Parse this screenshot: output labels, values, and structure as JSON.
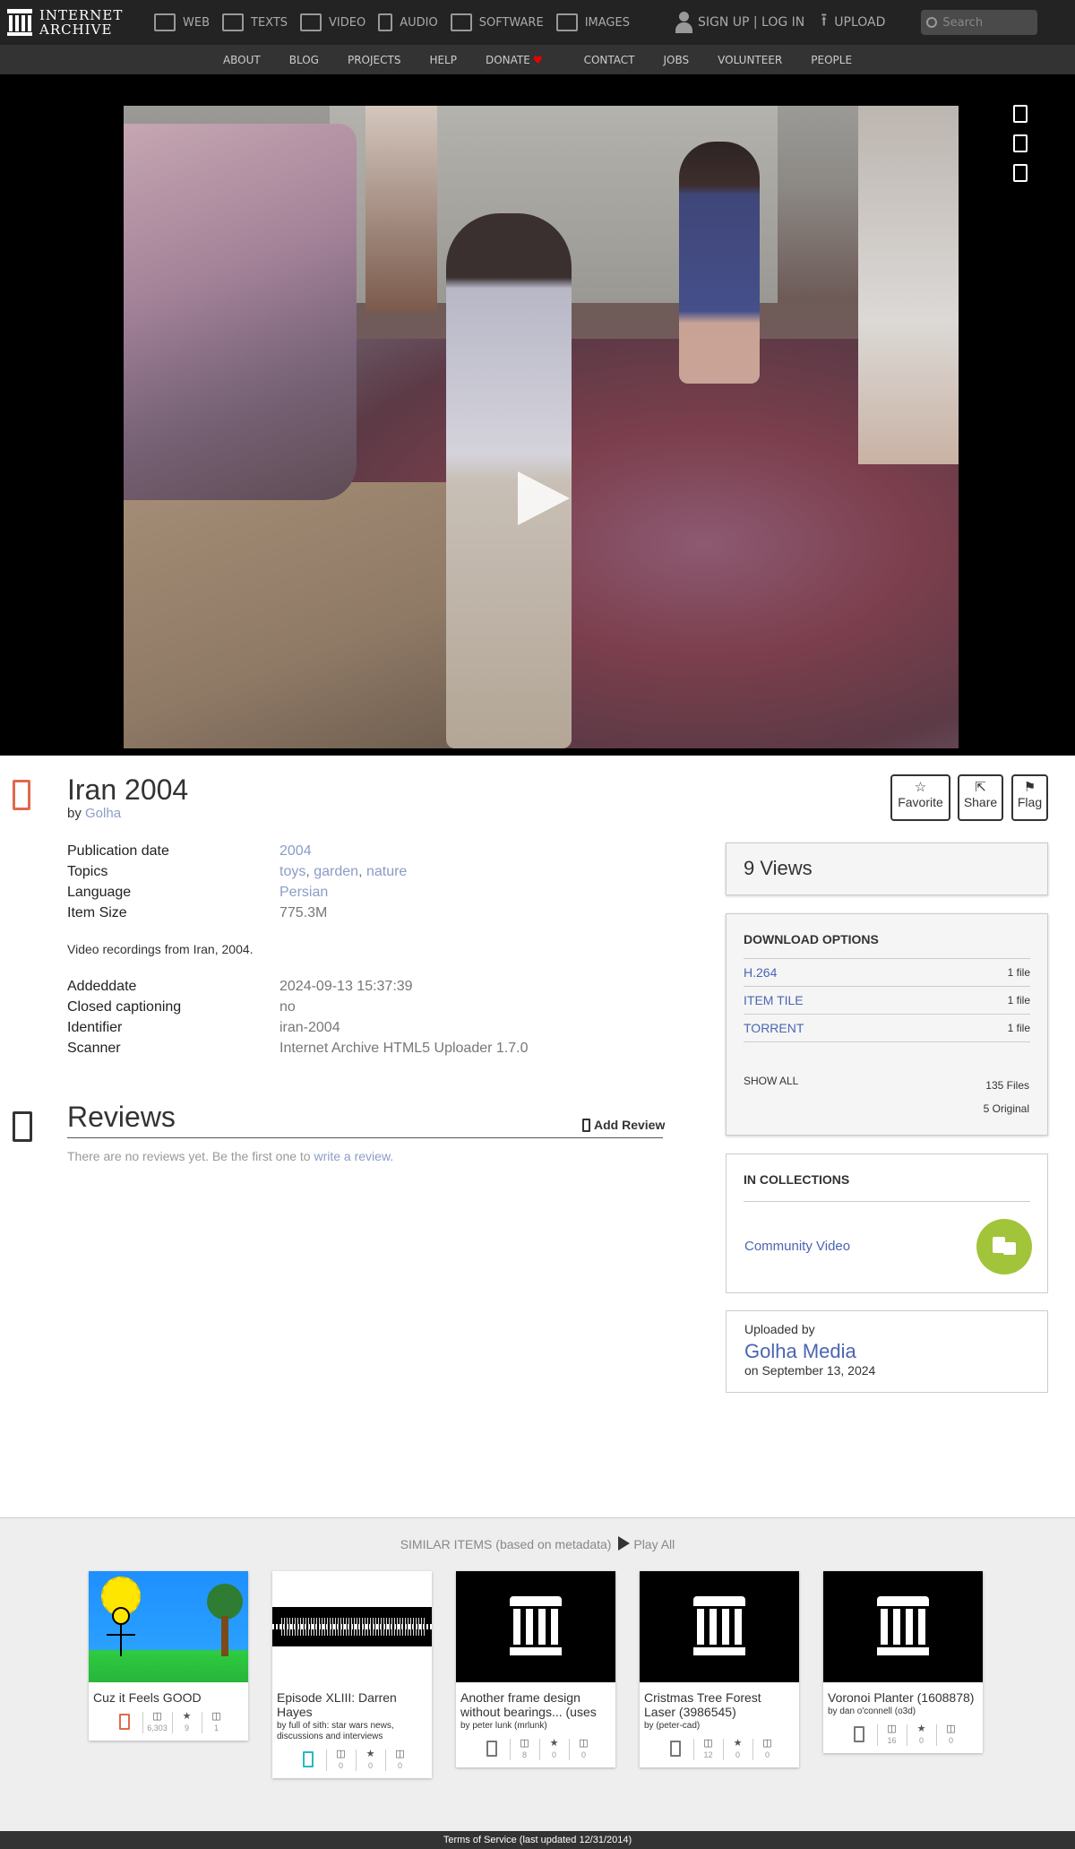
{
  "topnav": {
    "logo_line1": "INTERNET",
    "logo_line2": "ARCHIVE",
    "items": [
      {
        "label": "WEB",
        "icon": "web-icon"
      },
      {
        "label": "TEXTS",
        "icon": "book-icon"
      },
      {
        "label": "VIDEO",
        "icon": "film-icon"
      },
      {
        "label": "AUDIO",
        "icon": "speaker-icon"
      },
      {
        "label": "SOFTWARE",
        "icon": "floppy-icon"
      },
      {
        "label": "IMAGES",
        "icon": "image-icon"
      }
    ],
    "signup_label": "SIGN UP | LOG IN",
    "upload_label": "UPLOAD",
    "search_placeholder": "Search"
  },
  "subnav": [
    "ABOUT",
    "BLOG",
    "PROJECTS",
    "HELP",
    "DONATE",
    "CONTACT",
    "JOBS",
    "VOLUNTEER",
    "PEOPLE"
  ],
  "item": {
    "title": "Iran 2004",
    "by_prefix": "by",
    "creator": "Golha",
    "actions": {
      "favorite": "Favorite",
      "share": "Share",
      "flag": "Flag"
    },
    "metadata": {
      "pubdate_key": "Publication date",
      "pubdate": "2004",
      "topics_key": "Topics",
      "topics": [
        "toys",
        "garden",
        "nature"
      ],
      "language_key": "Language",
      "language": "Persian",
      "size_key": "Item Size",
      "size": "775.3M",
      "description": "Video recordings from Iran, 2004.",
      "addeddate_key": "Addeddate",
      "addeddate": "2024-09-13 15:37:39",
      "cc_key": "Closed captioning",
      "cc": "no",
      "identifier_key": "Identifier",
      "identifier": "iran-2004",
      "scanner_key": "Scanner",
      "scanner": "Internet Archive HTML5 Uploader 1.7.0"
    }
  },
  "reviews": {
    "title": "Reviews",
    "add_label": "Add Review",
    "empty_text": "There are no reviews yet. Be the first one to",
    "empty_link": "write a review",
    "empty_end": "."
  },
  "sidebar": {
    "views": "9 Views",
    "download_title": "DOWNLOAD OPTIONS",
    "downloads": [
      {
        "name": "H.264",
        "count": "1 file"
      },
      {
        "name": "ITEM TILE",
        "count": "1 file"
      },
      {
        "name": "TORRENT",
        "count": "1 file"
      }
    ],
    "show_all": "SHOW ALL",
    "total_files": "135 Files",
    "original_files": "5 Original",
    "collections_title": "IN COLLECTIONS",
    "collection": "Community Video",
    "uploaded_by_label": "Uploaded by",
    "uploader": "Golha Media",
    "uploaded_on": "on September 13, 2024"
  },
  "similar": {
    "heading": "SIMILAR ITEMS (based on metadata)",
    "play_all": "Play All",
    "cards": [
      {
        "title": "Cuz it Feels GOOD",
        "by": "",
        "views": "6,303",
        "favs": "9",
        "reviews": "1",
        "media": "movies"
      },
      {
        "title": "Episode XLIII: Darren Hayes",
        "by": "by full of sith: star wars news, discussions and interviews",
        "views": "0",
        "favs": "0",
        "reviews": "0",
        "media": "audio"
      },
      {
        "title": "Another frame design without bearings... (uses",
        "by": "by peter lunk (mrlunk)",
        "views": "8",
        "favs": "0",
        "reviews": "0",
        "media": "data"
      },
      {
        "title": "Cristmas Tree Forest Laser (3986545)",
        "by": "by (peter-cad)",
        "views": "12",
        "favs": "0",
        "reviews": "0",
        "media": "data"
      },
      {
        "title": "Voronoi Planter (1608878)",
        "by": "by dan o'connell (o3d)",
        "views": "16",
        "favs": "0",
        "reviews": "0",
        "media": "data"
      }
    ]
  },
  "footer": "Terms of Service (last updated 12/31/2014)",
  "colors": {
    "link": "#4a65b3",
    "light_link": "#8b9cc7",
    "movie_accent": "#e06a4c",
    "collection_badge": "#a2c43a"
  }
}
